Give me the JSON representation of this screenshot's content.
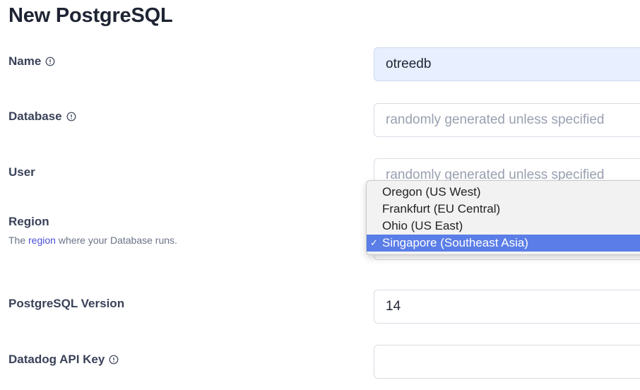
{
  "page": {
    "title": "New PostgreSQL"
  },
  "fields": {
    "name": {
      "label": "Name",
      "value": "otreedb",
      "icon": "info-icon"
    },
    "database": {
      "label": "Database",
      "placeholder": "randomly generated unless specified",
      "icon": "info-icon"
    },
    "user": {
      "label": "User",
      "placeholder": "randomly generated unless specified"
    },
    "region": {
      "label": "Region",
      "help_prefix": "The ",
      "help_link": "region",
      "help_suffix": " where your Database runs.",
      "options": [
        "Oregon (US West)",
        "Frankfurt (EU Central)",
        "Ohio (US East)",
        "Singapore (Southeast Asia)"
      ],
      "selected": "Singapore (Southeast Asia)",
      "check_mark": "✓"
    },
    "version": {
      "label": "PostgreSQL Version",
      "value": "14"
    },
    "datadog": {
      "label": "Datadog API Key",
      "value": "",
      "icon": "info-icon"
    }
  },
  "colors": {
    "accent": "#4a4fd6",
    "selected_option": "#5a7de7",
    "filled_input": "#e8efff"
  }
}
